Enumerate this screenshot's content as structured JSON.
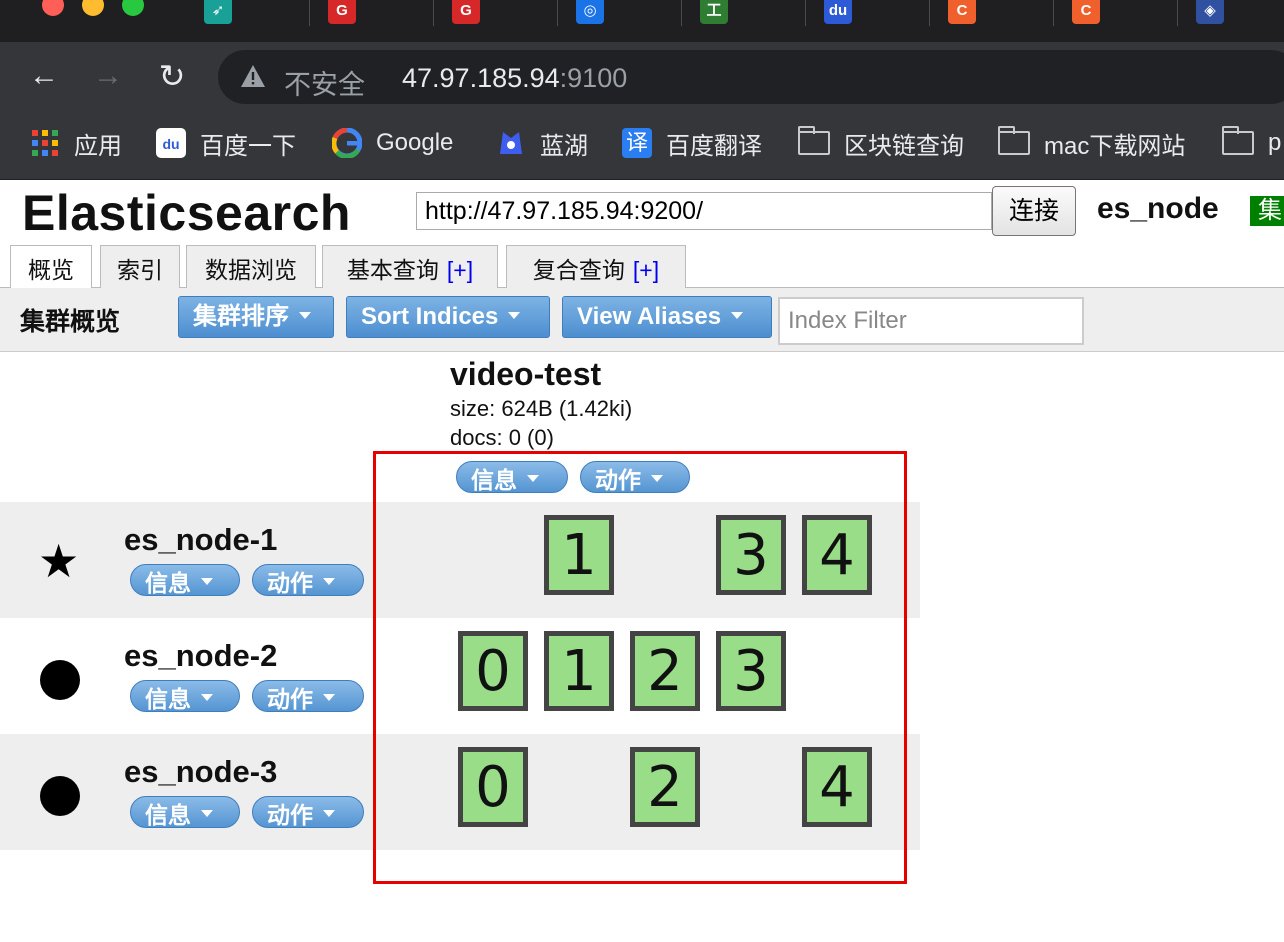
{
  "browser": {
    "tab_favicons": [
      {
        "name": "tab-1",
        "glyph": "➶",
        "color": "#1aa197"
      },
      {
        "name": "tab-2",
        "glyph": "G",
        "color": "#d62828"
      },
      {
        "name": "tab-3",
        "glyph": "G",
        "color": "#d62828"
      },
      {
        "name": "tab-4",
        "glyph": "◎",
        "color": "#1b73e8"
      },
      {
        "name": "tab-5",
        "glyph": "工",
        "color": "#2e7d32"
      },
      {
        "name": "tab-6",
        "glyph": "du",
        "color": "#2d5bd8"
      },
      {
        "name": "tab-7",
        "glyph": "C",
        "color": "#f0602c"
      },
      {
        "name": "tab-8",
        "glyph": "C",
        "color": "#f0602c"
      },
      {
        "name": "tab-9",
        "glyph": "◈",
        "color": "#3050a0"
      }
    ],
    "security_label": "不安全",
    "url_host": "47.97.185.94",
    "url_port": ":9100",
    "bookmarks": [
      "应用",
      "百度一下",
      "Google",
      "蓝湖",
      "百度翻译",
      "区块链查询",
      "mac下载网站",
      "p"
    ]
  },
  "header": {
    "title": "Elasticsearch",
    "connect_url": "http://47.97.185.94:9200/",
    "connect_label": "连接",
    "cluster_name": "es_node",
    "health_text": "集",
    "health_color": "#008000"
  },
  "tabs": [
    {
      "label": "概览",
      "plus": ""
    },
    {
      "label": "索引",
      "plus": ""
    },
    {
      "label": "数据浏览",
      "plus": ""
    },
    {
      "label": "基本查询",
      "plus": "[+]"
    },
    {
      "label": "复合查询",
      "plus": "[+]"
    }
  ],
  "overview": {
    "title": "集群概览",
    "sort_cluster_label": "集群排序",
    "sort_indices_label": "Sort Indices",
    "view_aliases_label": "View Aliases",
    "index_filter_placeholder": "Index Filter"
  },
  "index": {
    "name": "video-test",
    "size": "size: 624B (1.42ki)",
    "docs": "docs: 0 (0)",
    "info_label": "信息",
    "action_label": "动作"
  },
  "nodes": [
    {
      "name": "es_node-1",
      "marker": "star",
      "info_label": "信息",
      "action_label": "动作",
      "shards": [
        "",
        "1",
        "",
        "3",
        "4"
      ]
    },
    {
      "name": "es_node-2",
      "marker": "dot",
      "info_label": "信息",
      "action_label": "动作",
      "shards": [
        "0",
        "1",
        "2",
        "3",
        ""
      ]
    },
    {
      "name": "es_node-3",
      "marker": "dot",
      "info_label": "信息",
      "action_label": "动作",
      "shards": [
        "0",
        "",
        "2",
        "",
        "4"
      ]
    }
  ],
  "colors": {
    "shard_fill": "#99dd88",
    "shard_border": "#444444",
    "highlight": "#e60000",
    "button_blue": "#5595d2"
  }
}
